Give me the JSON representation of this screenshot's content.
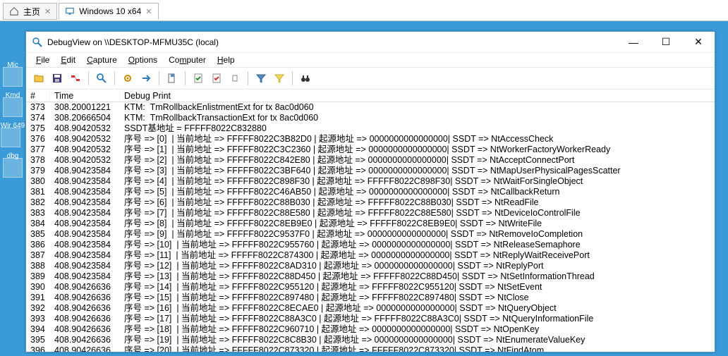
{
  "host": {
    "tabs": [
      {
        "label": "主页",
        "icon": "home-icon"
      },
      {
        "label": "Windows 10 x64",
        "icon": "monitor-icon",
        "active": true
      }
    ]
  },
  "desktop": {
    "icons": [
      {
        "label": "Mic"
      },
      {
        "label": "Kmd"
      },
      {
        "label": "Wir\n649"
      },
      {
        "label": "dbg"
      }
    ]
  },
  "debugview": {
    "title": "DebugView on \\\\DESKTOP-MFMU35C (local)",
    "menu": [
      {
        "label": "File",
        "hotkey": "F"
      },
      {
        "label": "Edit",
        "hotkey": "E"
      },
      {
        "label": "Capture",
        "hotkey": "C"
      },
      {
        "label": "Options",
        "hotkey": "O"
      },
      {
        "label": "Computer",
        "hotkey": "m"
      },
      {
        "label": "Help",
        "hotkey": "H"
      }
    ],
    "toolbar": [
      {
        "name": "open-icon",
        "type": "icon"
      },
      {
        "name": "save-icon",
        "type": "icon"
      },
      {
        "name": "disconnect-icon",
        "type": "icon"
      },
      {
        "type": "sep"
      },
      {
        "name": "search-icon",
        "type": "icon"
      },
      {
        "type": "sep"
      },
      {
        "name": "gear-icon",
        "type": "icon"
      },
      {
        "name": "arrow-right-icon",
        "type": "icon"
      },
      {
        "type": "sep"
      },
      {
        "name": "doc-icon",
        "type": "icon"
      },
      {
        "type": "sep"
      },
      {
        "name": "check-doc-icon",
        "type": "icon"
      },
      {
        "name": "check-doc2-icon",
        "type": "icon"
      },
      {
        "name": "small-doc-icon",
        "type": "icon"
      },
      {
        "type": "sep"
      },
      {
        "name": "funnel-icon",
        "type": "icon"
      },
      {
        "name": "highlight-icon",
        "type": "icon"
      },
      {
        "type": "sep"
      },
      {
        "name": "binoculars-icon",
        "type": "icon"
      }
    ],
    "columns": {
      "hash": "#",
      "time": "Time",
      "debug": "Debug Print"
    },
    "rows": [
      {
        "n": "373",
        "t": "308.20001221",
        "d": "KTM:  TmRollbackEnlistmentExt for tx 8ac0d060"
      },
      {
        "n": "374",
        "t": "308.20666504",
        "d": "KTM:  TmRollbackTransactionExt for tx 8ac0d060"
      },
      {
        "n": "375",
        "t": "408.90420532",
        "d": "SSDT基地址 = FFFFF8022C832880"
      },
      {
        "n": "376",
        "t": "408.90420532",
        "d": "序号 => [0]  | 当前地址 => FFFFF8022C3B82D0 | 起源地址 => 0000000000000000| SSDT => NtAccessCheck"
      },
      {
        "n": "377",
        "t": "408.90420532",
        "d": "序号 => [1]  | 当前地址 => FFFFF8022C3C2360 | 起源地址 => 0000000000000000| SSDT => NtWorkerFactoryWorkerReady"
      },
      {
        "n": "378",
        "t": "408.90420532",
        "d": "序号 => [2]  | 当前地址 => FFFFF8022C842E80 | 起源地址 => 0000000000000000| SSDT => NtAcceptConnectPort"
      },
      {
        "n": "379",
        "t": "408.90423584",
        "d": "序号 => [3]  | 当前地址 => FFFFF8022C3BF640 | 起源地址 => 0000000000000000| SSDT => NtMapUserPhysicalPagesScatter"
      },
      {
        "n": "380",
        "t": "408.90423584",
        "d": "序号 => [4]  | 当前地址 => FFFFF8022C898F30 | 起源地址 => FFFFF8022C898F30| SSDT => NtWaitForSingleObject"
      },
      {
        "n": "381",
        "t": "408.90423584",
        "d": "序号 => [5]  | 当前地址 => FFFFF8022C46AB50 | 起源地址 => 0000000000000000| SSDT => NtCallbackReturn"
      },
      {
        "n": "382",
        "t": "408.90423584",
        "d": "序号 => [6]  | 当前地址 => FFFFF8022C88B030 | 起源地址 => FFFFF8022C88B030| SSDT => NtReadFile"
      },
      {
        "n": "383",
        "t": "408.90423584",
        "d": "序号 => [7]  | 当前地址 => FFFFF8022C88E580 | 起源地址 => FFFFF8022C88E580| SSDT => NtDeviceIoControlFile"
      },
      {
        "n": "384",
        "t": "408.90423584",
        "d": "序号 => [8]  | 当前地址 => FFFFF8022C8EB9E0 | 起源地址 => FFFFF8022C8EB9E0| SSDT => NtWriteFile"
      },
      {
        "n": "385",
        "t": "408.90423584",
        "d": "序号 => [9]  | 当前地址 => FFFFF8022C9537F0 | 起源地址 => 0000000000000000| SSDT => NtRemoveIoCompletion"
      },
      {
        "n": "386",
        "t": "408.90423584",
        "d": "序号 => [10]  | 当前地址 => FFFFF8022C955760 | 起源地址 => 0000000000000000| SSDT => NtReleaseSemaphore"
      },
      {
        "n": "387",
        "t": "408.90423584",
        "d": "序号 => [11]  | 当前地址 => FFFFF8022C874300 | 起源地址 => 0000000000000000| SSDT => NtReplyWaitReceivePort"
      },
      {
        "n": "388",
        "t": "408.90423584",
        "d": "序号 => [12]  | 当前地址 => FFFFF8022C8AD310 | 起源地址 => 0000000000000000| SSDT => NtReplyPort"
      },
      {
        "n": "389",
        "t": "408.90423584",
        "d": "序号 => [13]  | 当前地址 => FFFFF8022C88D450 | 起源地址 => FFFFF8022C88D450| SSDT => NtSetInformationThread"
      },
      {
        "n": "390",
        "t": "408.90426636",
        "d": "序号 => [14]  | 当前地址 => FFFFF8022C955120 | 起源地址 => FFFFF8022C955120| SSDT => NtSetEvent"
      },
      {
        "n": "391",
        "t": "408.90426636",
        "d": "序号 => [15]  | 当前地址 => FFFFF8022C897480 | 起源地址 => FFFFF8022C897480| SSDT => NtClose"
      },
      {
        "n": "392",
        "t": "408.90426636",
        "d": "序号 => [16]  | 当前地址 => FFFFF8022C8ECAE0 | 起源地址 => 0000000000000000| SSDT => NtQueryObject"
      },
      {
        "n": "393",
        "t": "408.90426636",
        "d": "序号 => [17]  | 当前地址 => FFFFF8022C88A3C0 | 起源地址 => FFFFF8022C88A3C0| SSDT => NtQueryInformationFile"
      },
      {
        "n": "394",
        "t": "408.90426636",
        "d": "序号 => [18]  | 当前地址 => FFFFF8022C960710 | 起源地址 => 0000000000000000| SSDT => NtOpenKey"
      },
      {
        "n": "395",
        "t": "408.90426636",
        "d": "序号 => [19]  | 当前地址 => FFFFF8022C8C8B30 | 起源地址 => 0000000000000000| SSDT => NtEnumerateValueKey"
      },
      {
        "n": "396",
        "t": "408.90426636",
        "d": "序号 => [20]  | 当前地址 => FFFFF8022C873320 | 起源地址 => FFFFF8022C873320| SSDT => NtFindAtom"
      }
    ]
  }
}
